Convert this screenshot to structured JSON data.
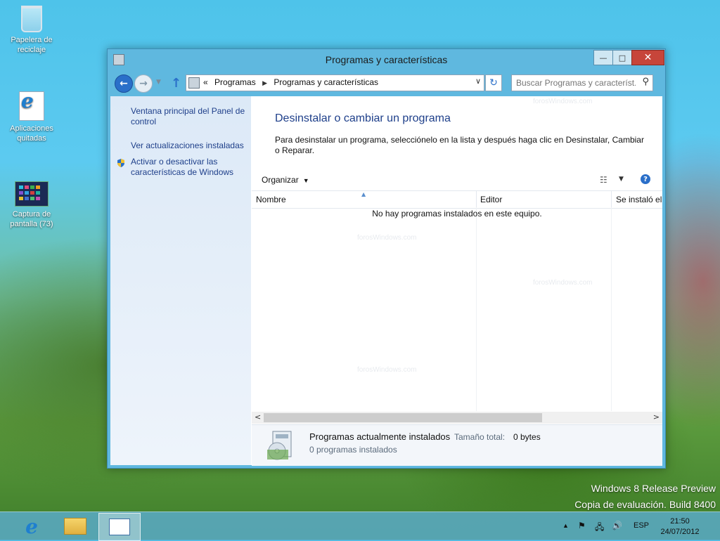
{
  "desktop": {
    "icons": [
      {
        "label": "Papelera de reciclaje"
      },
      {
        "label": "Aplicaciones quitadas"
      },
      {
        "label": "Captura de pantalla (73)"
      }
    ],
    "build_line1": "Windows 8 Release Preview",
    "build_line2": "Copia de evaluación. Build 8400"
  },
  "window": {
    "title": "Programas y características",
    "controls": {
      "minimize": "—",
      "maximize": "□",
      "close": "✕"
    },
    "address": {
      "prefix": "«",
      "crumbs": [
        "Programas",
        "Programas y características"
      ]
    },
    "search": {
      "placeholder": "Buscar Programas y característ..."
    },
    "sidebar": {
      "links": [
        "Ventana principal del Panel de control",
        "Ver actualizaciones instaladas",
        "Activar o desactivar las características de Windows"
      ]
    },
    "main": {
      "title": "Desinstalar o cambiar un programa",
      "description": "Para desinstalar un programa, selecciónelo en la lista y después haga clic en Desinstalar, Cambiar o Reparar.",
      "toolbar": {
        "organize": "Organizar"
      },
      "columns": [
        "Nombre",
        "Editor",
        "Se instaló el"
      ],
      "empty_message": "No hay programas instalados en este equipo.",
      "scroll_fraction": 0.72
    },
    "details": {
      "title": "Programas actualmente instalados",
      "size_label": "Tamaño total:",
      "size_value": "0 bytes",
      "count": "0 programas instalados"
    }
  },
  "taskbar": {
    "items": [
      "internet-explorer",
      "file-explorer",
      "control-panel"
    ],
    "language": "ESP",
    "time": "21:50",
    "date": "24/07/2012"
  },
  "watermark": "forosWindows.com",
  "colors": {
    "link": "#1e3f8a",
    "accent": "#2a6fc9",
    "close": "#c7453a"
  }
}
